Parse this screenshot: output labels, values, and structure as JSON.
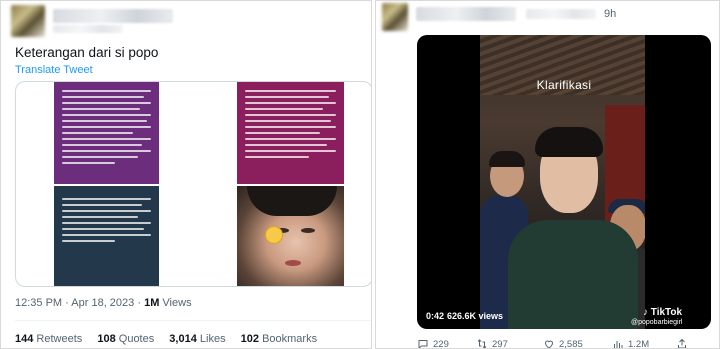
{
  "left_tweet": {
    "text": "Keterangan dari si popo",
    "translate_link": "Translate Tweet",
    "time": "12:35 PM",
    "date": "Apr 18, 2023",
    "views_count": "1M",
    "views_label": "Views",
    "stats": [
      {
        "count": "144",
        "label": "Retweets"
      },
      {
        "count": "108",
        "label": "Quotes"
      },
      {
        "count": "3,014",
        "label": "Likes"
      },
      {
        "count": "102",
        "label": "Bookmarks"
      }
    ]
  },
  "right_tweet": {
    "time": "9h",
    "video": {
      "overlay_title": "Klarifikasi",
      "duration": "0:42",
      "views": "626.6K views",
      "tiktok_brand": "TikTok",
      "tiktok_user": "@popobarbiegirl"
    },
    "actions": {
      "replies": "229",
      "retweets": "297",
      "likes": "2,585",
      "views": "1.2M"
    }
  },
  "colors": {
    "link": "#1d9bf0",
    "muted": "#536471",
    "text": "#0f1419",
    "purple_card": "#6b2d7c",
    "magenta_card": "#8b1f5e",
    "dark_card": "#24384b"
  },
  "icons": [
    "reply-icon",
    "retweet-icon",
    "like-icon",
    "views-icon",
    "share-icon"
  ]
}
